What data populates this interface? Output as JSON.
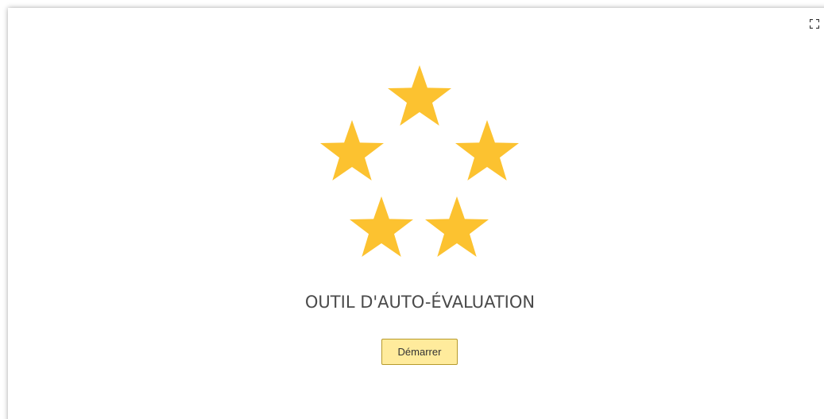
{
  "main": {
    "title": "OUTIL D'AUTO-ÉVALUATION",
    "start_button_label": "Démarrer"
  },
  "icons": {
    "fullscreen": "fullscreen-icon",
    "star": "star-icon"
  },
  "colors": {
    "star": "#fcc230",
    "button_background": "#ffeb9c",
    "button_border": "#b79a2c",
    "title_text": "#4a4a4a"
  }
}
